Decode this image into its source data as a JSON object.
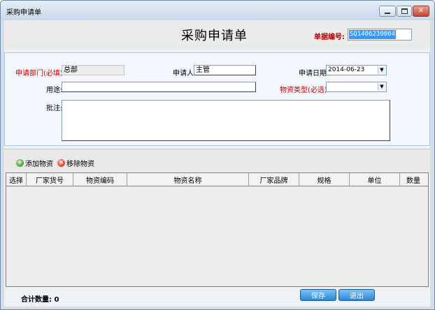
{
  "window": {
    "title": "采购申请单"
  },
  "header": {
    "title": "采购申请单",
    "doc_no_label": "单据编号:",
    "doc_no_value": "SQ1406230004"
  },
  "form": {
    "department_label": "申请部门(必填):",
    "department_value": "总部",
    "applicant_label": "申请人:",
    "applicant_value": "主管",
    "date_label": "申请日期:",
    "date_value": "2014-06-23",
    "purpose_label": "用途:",
    "purpose_value": "",
    "material_type_label": "物资类型(必选):",
    "material_type_value": "",
    "remark_label": "批注:",
    "remark_value": ""
  },
  "toolbar": {
    "add_label": "添加物资",
    "remove_label": "移除物资"
  },
  "grid": {
    "columns": [
      "选择",
      "厂家货号",
      "物资编码",
      "物资名称",
      "厂家品牌",
      "规格",
      "单位",
      "数量"
    ],
    "rows": []
  },
  "footer": {
    "total_label": "合计数量:",
    "total_value": "0",
    "save_label": "保存",
    "exit_label": "退出"
  },
  "colors": {
    "required": "#c00000",
    "accent": "#2a88d6",
    "selection": "#3399ff"
  }
}
